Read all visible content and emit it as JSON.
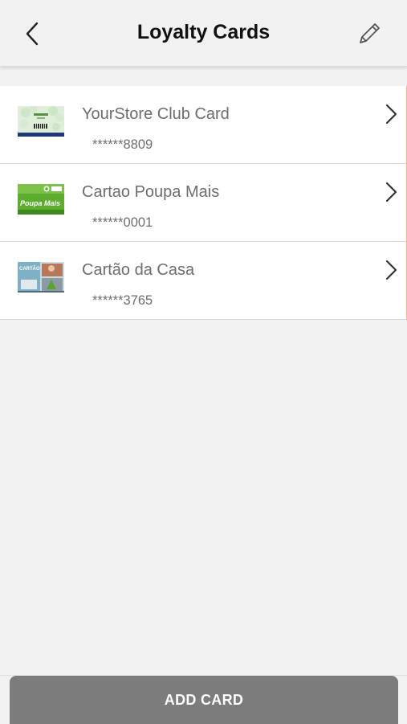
{
  "header": {
    "title": "Loyalty Cards",
    "back_icon": "chevron-left-icon",
    "edit_icon": "pencil-icon"
  },
  "cards": [
    {
      "name": "YourStore Club Card",
      "number": "******8809",
      "thumb_icon": "club-card-image"
    },
    {
      "name": "Cartao Poupa Mais",
      "number": "******0001",
      "thumb_icon": "poupa-mais-card-image",
      "thumb_text": "Poupa Mais"
    },
    {
      "name": "Cartão da Casa",
      "number": "******3765",
      "thumb_icon": "cartao-casa-card-image",
      "thumb_text": "CARTÃO CASA"
    }
  ],
  "footer": {
    "add_label": "ADD CARD"
  },
  "colors": {
    "background": "#f2f2f2",
    "button": "#7c7c7c",
    "text_secondary": "#6e6e6e",
    "accent_border": "#f3b58f"
  }
}
